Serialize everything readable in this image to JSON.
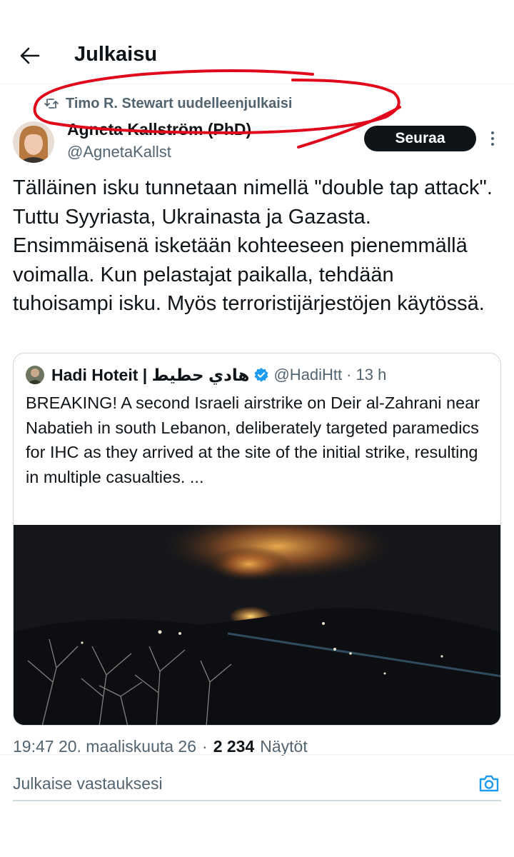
{
  "header": {
    "title": "Julkaisu",
    "back_icon": "arrow-left-icon"
  },
  "repost": {
    "icon": "repost-icon",
    "text": "Timo R. Stewart uudelleenjulkaisi",
    "annotation_color": "#e0081b"
  },
  "author": {
    "name": "Agneta Kallström (PhD)",
    "handle": "@AgnetaKallst",
    "follow_label": "Seuraa",
    "more_icon": "more-vertical-icon"
  },
  "tweet": {
    "text": "Tälläinen isku tunnetaan nimellä \"double tap attack\". Tuttu Syyriasta, Ukrainasta ja Gazasta. Ensimmäisenä isketään kohteeseen pienemmällä voimalla. Kun pelastajat paikalla, tehdään tuhoisampi isku. Myös terroristijärjestöjen käytössä."
  },
  "quote": {
    "name": "Hadi Hoteit | هادي حطيط",
    "verified_icon": "verified-badge-icon",
    "handle": "@HadiHtt",
    "separator": "·",
    "time": "13 h",
    "text": "BREAKING! A second Israeli airstrike on Deir al-Zahrani near Nabatieh in south Lebanon, deliberately targeted paramedics for IHC as they arrived at the site of the initial strike, resulting in multiple casualties. ..."
  },
  "meta": {
    "timestamp": "19:47 20. maaliskuuta 26",
    "separator": "·",
    "views_count": "2 234",
    "views_label": "Näytöt"
  },
  "reply": {
    "placeholder": "Julkaise vastauksesi",
    "camera_icon": "camera-icon"
  },
  "colors": {
    "accent": "#1d9bf0",
    "text_primary": "#0f1419",
    "text_secondary": "#536471",
    "border": "#cfd9de"
  }
}
